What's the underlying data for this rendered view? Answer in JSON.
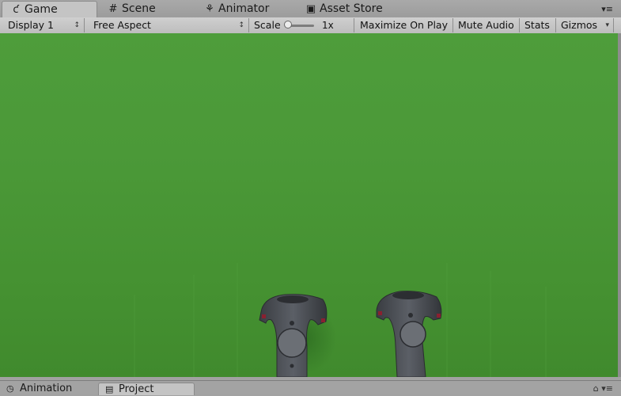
{
  "tabs": [
    {
      "label": "Game",
      "icon": "pacman-icon",
      "glyph": "ƈ"
    },
    {
      "label": "Scene",
      "icon": "grid-icon",
      "glyph": "#"
    },
    {
      "label": "Animator",
      "icon": "animator-icon",
      "glyph": "⚘"
    },
    {
      "label": "Asset Store",
      "icon": "store-bag-icon",
      "glyph": "▣"
    }
  ],
  "tab_menu_glyph": "▾≡",
  "toolbar": {
    "display_label": "Display 1",
    "aspect_label": "Free Aspect",
    "scale_label": "Scale",
    "scale_value": "1x",
    "scale_slider_level": 0.0,
    "maximize_label": "Maximize On Play",
    "mute_label": "Mute Audio",
    "stats_label": "Stats",
    "gizmos_label": "Gizmos",
    "dropdown_glyph": "↕",
    "gizmos_arrow": "▾"
  },
  "viewport": {
    "background_color": "#4b9938",
    "controllers": [
      "left-vr-controller",
      "right-vr-controller"
    ]
  },
  "bottom_tabs": [
    {
      "label": "Animation",
      "icon": "clock-icon",
      "glyph": "◷"
    },
    {
      "label": "Project",
      "icon": "folder-icon",
      "glyph": "▤"
    }
  ],
  "bottom_icons_glyph": "⌂ ▾≡"
}
